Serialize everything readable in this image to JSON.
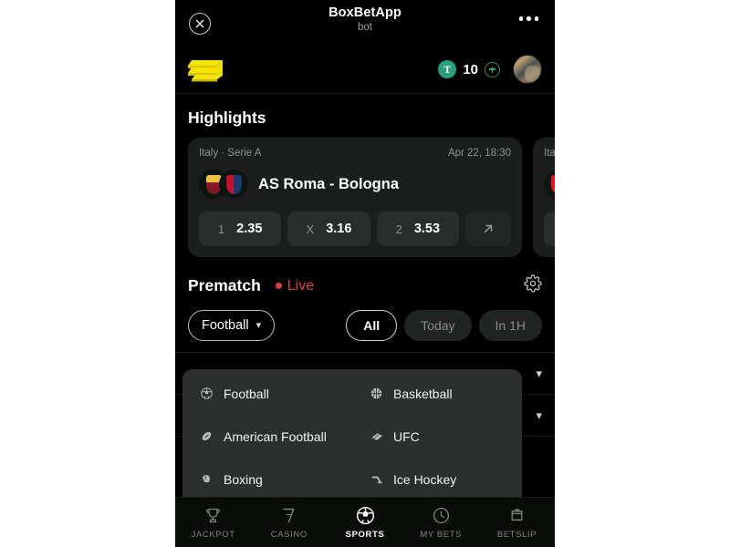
{
  "header": {
    "title": "BoxBetApp",
    "subtitle": "bot",
    "close_icon": "close-circle-icon",
    "more_icon": "more-horizontal-icon"
  },
  "brand_bar": {
    "logo_icon": "gold-bars-logo",
    "balance": {
      "currency_symbol": "T",
      "currency_name": "tether-icon",
      "amount": "10",
      "add_icon": "plus-circle-icon"
    },
    "avatar_icon": "user-avatar"
  },
  "highlights": {
    "title": "Highlights",
    "cards": [
      {
        "league": "Italy · Serie A",
        "time": "Apr 22, 18:30",
        "match": "AS Roma - Bologna",
        "home_crest": "as-roma-crest",
        "away_crest": "bologna-crest",
        "odds": [
          {
            "key": "1",
            "value": "2.35"
          },
          {
            "key": "X",
            "value": "3.16"
          },
          {
            "key": "2",
            "value": "3.53"
          }
        ],
        "more_icon": "arrow-up-right-icon"
      },
      {
        "league": "Ita",
        "time": "",
        "match": "",
        "home_crest": "ac-milan-crest",
        "away_crest": "",
        "odds": [],
        "more_icon": ""
      }
    ]
  },
  "prematch": {
    "title": "Prematch",
    "live_label": "Live",
    "settings_icon": "gear-icon",
    "sport_selected": "Football",
    "sport_chevron": "chevron-down-icon",
    "time_filters": [
      {
        "label": "All",
        "active": true
      },
      {
        "label": "Today",
        "active": false
      },
      {
        "label": "In 1H",
        "active": false
      }
    ],
    "league_rows": [
      {
        "chevron": "chevron-down-icon"
      },
      {
        "chevron": "chevron-down-icon"
      }
    ]
  },
  "sport_dropdown": {
    "open": true,
    "items": [
      {
        "label": "Football",
        "icon": "soccer-ball-icon"
      },
      {
        "label": "Basketball",
        "icon": "basketball-icon"
      },
      {
        "label": "American Football",
        "icon": "american-football-icon"
      },
      {
        "label": "UFC",
        "icon": "ufc-gloves-icon"
      },
      {
        "label": "Boxing",
        "icon": "boxing-glove-icon"
      },
      {
        "label": "Ice Hockey",
        "icon": "ice-hockey-icon"
      }
    ]
  },
  "bottom_nav": {
    "items": [
      {
        "label": "JACKPOT",
        "icon": "trophy-icon",
        "active": false
      },
      {
        "label": "CASINO",
        "icon": "seven-icon",
        "active": false
      },
      {
        "label": "SPORTS",
        "icon": "soccer-ball-icon",
        "active": true
      },
      {
        "label": "MY BETS",
        "icon": "clock-icon",
        "active": false
      },
      {
        "label": "BETSLIP",
        "icon": "betslip-icon",
        "active": false
      }
    ]
  },
  "colors": {
    "accent_green": "#26a17b",
    "live_red": "#d8414a",
    "logo_gold": "#f3e100",
    "card_bg": "#1b1e1d",
    "dropdown_bg": "#2c2f2e"
  }
}
